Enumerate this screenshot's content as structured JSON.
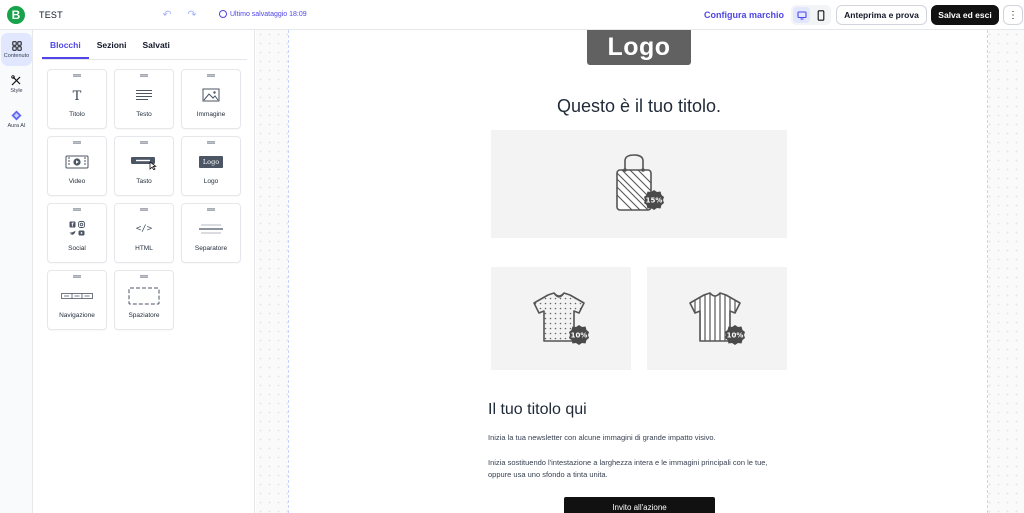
{
  "header": {
    "brand_letter": "B",
    "title": "TEST",
    "undo_symbol": "↶",
    "redo_symbol": "↷",
    "saved_label": "Ultimo salvataggio 18:09",
    "configure_brand": "Configura marchio",
    "preview_label": "Anteprima e prova",
    "save_label": "Salva ed esci",
    "more_symbol": "⋮"
  },
  "rail": {
    "items": [
      {
        "label": "Contenuto",
        "icon": "grid-icon",
        "active": true
      },
      {
        "label": "Style",
        "icon": "brush-icon",
        "active": false
      },
      {
        "label": "Aura AI",
        "icon": "sparkle-icon",
        "active": false
      }
    ]
  },
  "panel": {
    "tabs": [
      {
        "label": "Blocchi",
        "active": true
      },
      {
        "label": "Sezioni",
        "active": false
      },
      {
        "label": "Salvati",
        "active": false
      }
    ],
    "blocks": [
      {
        "label": "Titolo",
        "icon": "title-icon"
      },
      {
        "label": "Testo",
        "icon": "text-icon"
      },
      {
        "label": "Immagine",
        "icon": "image-icon"
      },
      {
        "label": "Video",
        "icon": "video-icon"
      },
      {
        "label": "Tasto",
        "icon": "button-icon"
      },
      {
        "label": "Logo",
        "icon": "logo-icon",
        "badge": "Logo"
      },
      {
        "label": "Social",
        "icon": "social-icon"
      },
      {
        "label": "HTML",
        "icon": "html-icon",
        "glyph": "</>"
      },
      {
        "label": "Separatore",
        "icon": "divider-icon"
      },
      {
        "label": "Navigazione",
        "icon": "navigation-icon"
      },
      {
        "label": "Spaziatore",
        "icon": "spacer-icon"
      }
    ]
  },
  "email": {
    "logo_text": "Logo",
    "heading": "Questo è il tuo titolo.",
    "images": [
      {
        "name": "bag-image",
        "badge": "15%"
      },
      {
        "name": "dotted-tshirt-image",
        "badge": "10%"
      },
      {
        "name": "striped-tshirt-image",
        "badge": "10%"
      }
    ],
    "subheading": "Il tuo titolo qui",
    "paragraph_1": "Inizia la tua newsletter con alcune immagini di grande impatto visivo.",
    "paragraph_2": "Inizia sostituendo l'intestazione a larghezza intera e le immagini principali con le tue, oppure usa uno sfondo a tinta unita.",
    "cta_label": "Invito all'azione"
  },
  "colors": {
    "accent": "#4f46e5",
    "brand_green": "#16a34a",
    "dark_button": "#111111",
    "image_bg": "#f3f3f3"
  }
}
